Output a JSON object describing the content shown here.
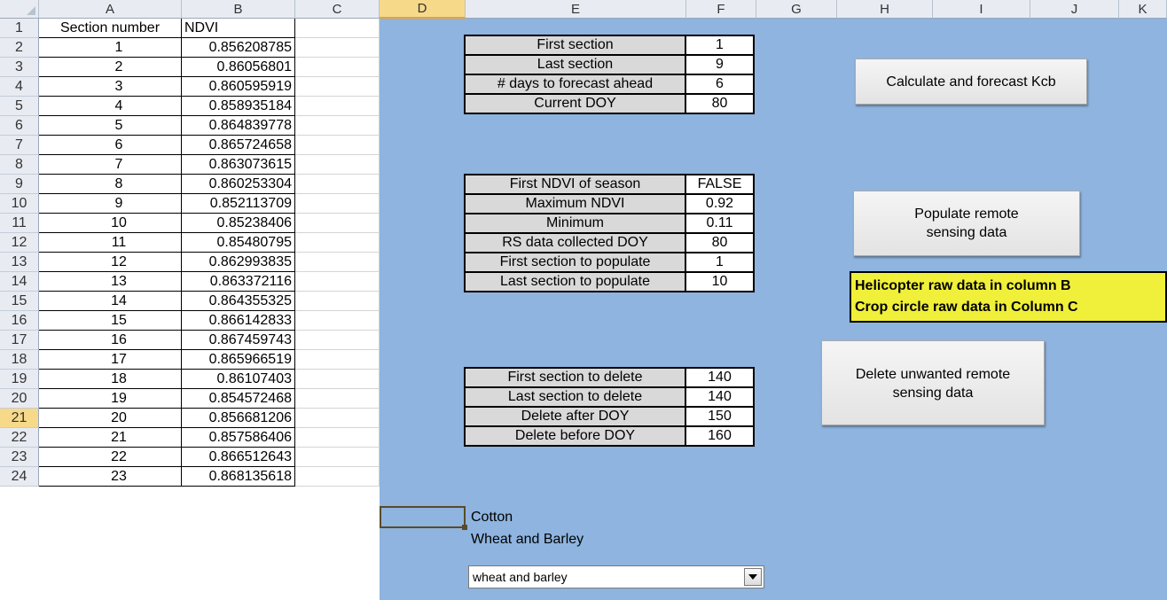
{
  "columns": [
    "A",
    "B",
    "C",
    "D",
    "E",
    "F",
    "G",
    "H",
    "I",
    "J",
    "K"
  ],
  "selected_column": "D",
  "selected_row": "21",
  "col_a_header": "Section number",
  "col_b_header": "NDVI",
  "rows": [
    {
      "n": "1",
      "a": "",
      "b": ""
    },
    {
      "n": "2",
      "a": "1",
      "b": "0.856208785"
    },
    {
      "n": "3",
      "a": "2",
      "b": "0.86056801"
    },
    {
      "n": "4",
      "a": "3",
      "b": "0.860595919"
    },
    {
      "n": "5",
      "a": "4",
      "b": "0.858935184"
    },
    {
      "n": "6",
      "a": "5",
      "b": "0.864839778"
    },
    {
      "n": "7",
      "a": "6",
      "b": "0.865724658"
    },
    {
      "n": "8",
      "a": "7",
      "b": "0.863073615"
    },
    {
      "n": "9",
      "a": "8",
      "b": "0.860253304"
    },
    {
      "n": "10",
      "a": "9",
      "b": "0.852113709"
    },
    {
      "n": "11",
      "a": "10",
      "b": "0.85238406"
    },
    {
      "n": "12",
      "a": "11",
      "b": "0.85480795"
    },
    {
      "n": "13",
      "a": "12",
      "b": "0.862993835"
    },
    {
      "n": "14",
      "a": "13",
      "b": "0.863372116"
    },
    {
      "n": "15",
      "a": "14",
      "b": "0.864355325"
    },
    {
      "n": "16",
      "a": "15",
      "b": "0.866142833"
    },
    {
      "n": "17",
      "a": "16",
      "b": "0.867459743"
    },
    {
      "n": "18",
      "a": "17",
      "b": "0.865966519"
    },
    {
      "n": "19",
      "a": "18",
      "b": "0.86107403"
    },
    {
      "n": "20",
      "a": "19",
      "b": "0.854572468"
    },
    {
      "n": "21",
      "a": "20",
      "b": "0.856681206"
    },
    {
      "n": "22",
      "a": "21",
      "b": "0.857586406"
    },
    {
      "n": "23",
      "a": "22",
      "b": "0.866512643"
    },
    {
      "n": "24",
      "a": "23",
      "b": "0.868135618"
    }
  ],
  "params_table1": [
    {
      "label": "First section",
      "value": "1"
    },
    {
      "label": "Last section",
      "value": "9"
    },
    {
      "label": "# days to forecast ahead",
      "value": "6"
    },
    {
      "label": "Current DOY",
      "value": "80"
    }
  ],
  "params_table2": [
    {
      "label": "First NDVI of season",
      "value": "FALSE"
    },
    {
      "label": "Maximum NDVI",
      "value": "0.92"
    },
    {
      "label": "Minimum",
      "value": "0.11"
    },
    {
      "label": "RS data collected DOY",
      "value": "80"
    },
    {
      "label": "First section to populate",
      "value": "1"
    },
    {
      "label": "Last section to populate",
      "value": "10"
    }
  ],
  "params_table3": [
    {
      "label": "First section to delete",
      "value": "140"
    },
    {
      "label": "Last section to delete",
      "value": "140"
    },
    {
      "label": "Delete after DOY",
      "value": "150"
    },
    {
      "label": "Delete before DOY",
      "value": "160"
    }
  ],
  "buttons": {
    "calculate": "Calculate and forecast Kcb",
    "populate_line1": "Populate remote",
    "populate_line2": "sensing data",
    "delete_line1": "Delete unwanted remote",
    "delete_line2": "sensing data"
  },
  "note": {
    "line1": "Helicopter raw data in column B",
    "line2": "Crop circle raw data in Column C"
  },
  "crop_labels": {
    "cotton": "Cotton",
    "wheat": "Wheat and Barley"
  },
  "combo": {
    "selected": "wheat and barley"
  },
  "colors": {
    "background_panel": "#8eb4df",
    "note_fill": "#f0ef3a",
    "label_cell": "#d9d9d9",
    "selected_header": "#f7d98a"
  }
}
